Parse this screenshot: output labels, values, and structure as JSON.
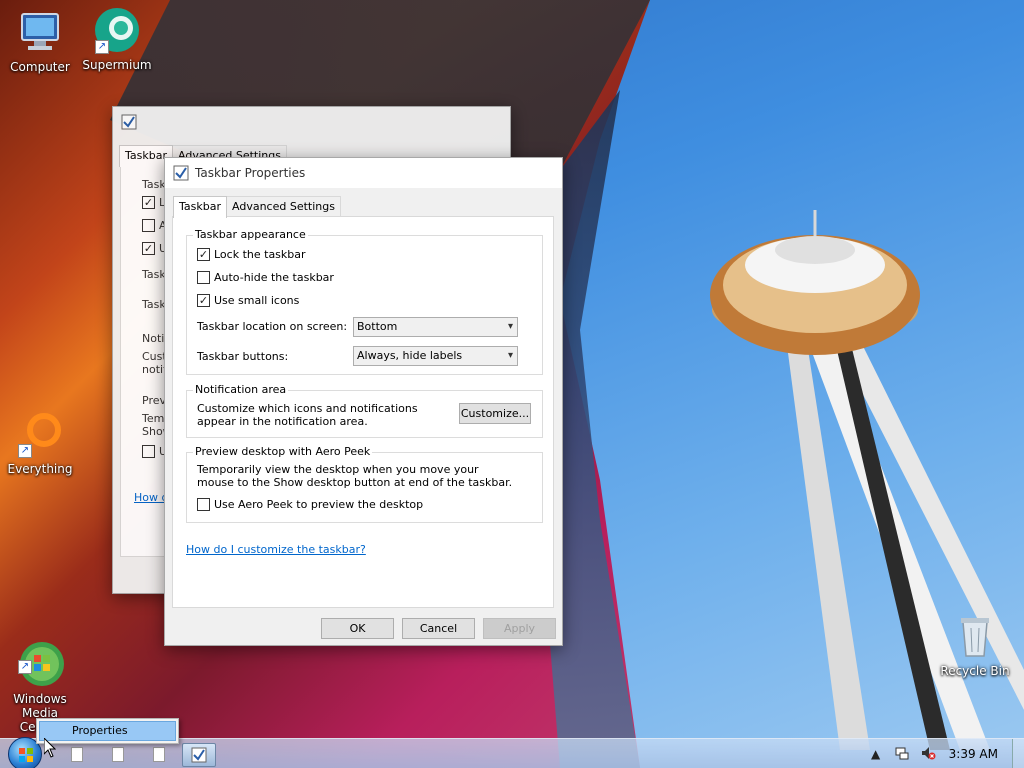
{
  "desktop": {
    "icons": [
      {
        "label": "Computer"
      },
      {
        "label": "Supermium"
      },
      {
        "label": "Everything"
      },
      {
        "label": "Windows\nMedia Center"
      },
      {
        "label": "Recycle Bin"
      }
    ]
  },
  "back_window": {
    "tabs": [
      "Taskbar",
      "Advanced Settings"
    ],
    "fragments": [
      "Task",
      "L",
      "A",
      "U",
      "Task",
      "Task",
      "Notif",
      "Cust",
      "notif",
      "Prev",
      "Temp",
      "Show",
      "U",
      "How d"
    ]
  },
  "dialog": {
    "title": "Taskbar Properties",
    "tabs": [
      "Taskbar",
      "Advanced Settings"
    ],
    "appearance": {
      "title": "Taskbar appearance",
      "lock_label": "Lock the taskbar",
      "lock_checked": true,
      "autohide_label": "Auto-hide the taskbar",
      "autohide_checked": false,
      "small_icons_label": "Use small icons",
      "small_icons_checked": true,
      "location_label": "Taskbar location on screen:",
      "location_value": "Bottom",
      "buttons_label": "Taskbar buttons:",
      "buttons_value": "Always, hide labels"
    },
    "notification": {
      "title": "Notification area",
      "description": "Customize which icons and notifications appear in the notification area.",
      "customize_label": "Customize..."
    },
    "peek": {
      "title": "Preview desktop with Aero Peek",
      "description": "Temporarily view the desktop when you move your mouse to the Show desktop button at end of the taskbar.",
      "use_peek_label": "Use Aero Peek to preview the desktop",
      "use_peek_checked": false
    },
    "help_link": "How do I customize the taskbar?",
    "ok_label": "OK",
    "cancel_label": "Cancel",
    "apply_label": "Apply"
  },
  "context_menu": {
    "items": [
      "Properties"
    ]
  },
  "taskbar": {
    "clock": "3:39 AM"
  },
  "check_glyph": "✓"
}
